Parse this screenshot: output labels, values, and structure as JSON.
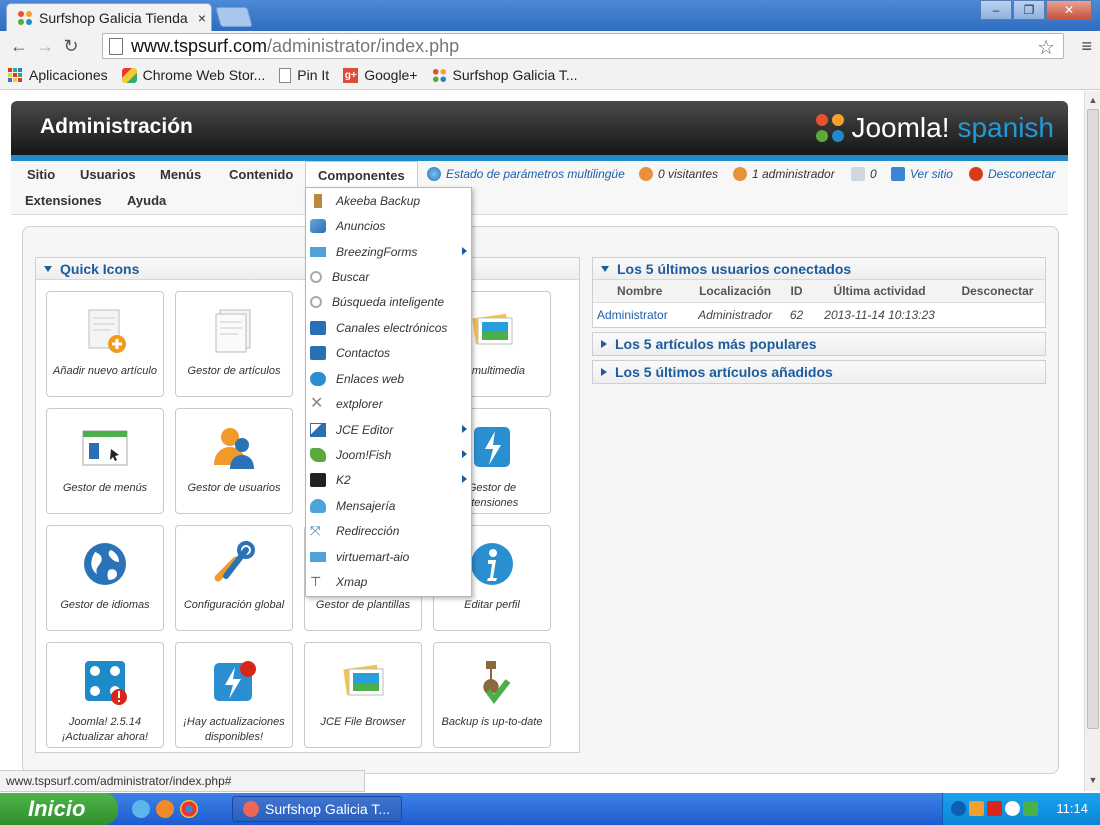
{
  "browser": {
    "tab_title": "Surfshop Galicia Tienda",
    "tab_close": "×",
    "url_host": "www.tspsurf.com",
    "url_path": "/administrator/index.php",
    "bookmarks": [
      "Aplicaciones",
      "Chrome Web Stor...",
      "Pin It",
      "Google+",
      "Surfshop Galicia T..."
    ],
    "status_url": "www.tspsurf.com/administrator/index.php#"
  },
  "header": {
    "title": "Administración",
    "logo_main": "Joomla!",
    "logo_lang": "spanish"
  },
  "menu": {
    "items": [
      "Sitio",
      "Usuarios",
      "Menús",
      "Contenido",
      "Componentes"
    ],
    "items_row2": [
      "Extensiones",
      "Ayuda"
    ],
    "status": {
      "multilang": "Estado de parámetros multilingüe",
      "visitors": "0 visitantes",
      "admins": "1 administrador",
      "messages": "0",
      "view_site": "Ver sitio",
      "logout": "Desconectar"
    }
  },
  "components_menu": [
    {
      "label": "Akeeba Backup",
      "icon": "akeeba-icon",
      "submenu": false
    },
    {
      "label": "Anuncios",
      "icon": "banners-icon",
      "submenu": false
    },
    {
      "label": "BreezingForms",
      "icon": "breezingforms-icon",
      "submenu": true
    },
    {
      "label": "Buscar",
      "icon": "search-icon",
      "submenu": false
    },
    {
      "label": "Búsqueda inteligente",
      "icon": "smart-search-icon",
      "submenu": false
    },
    {
      "label": "Canales electrónicos",
      "icon": "rss-icon",
      "submenu": false
    },
    {
      "label": "Contactos",
      "icon": "contacts-icon",
      "submenu": false
    },
    {
      "label": "Enlaces web",
      "icon": "weblinks-icon",
      "submenu": false
    },
    {
      "label": "extplorer",
      "icon": "extplorer-icon",
      "submenu": false
    },
    {
      "label": "JCE Editor",
      "icon": "jce-icon",
      "submenu": true
    },
    {
      "label": "Joom!Fish",
      "icon": "joomfish-icon",
      "submenu": true
    },
    {
      "label": "K2",
      "icon": "k2-icon",
      "submenu": true
    },
    {
      "label": "Mensajería",
      "icon": "messaging-icon",
      "submenu": false
    },
    {
      "label": "Redirección",
      "icon": "redirect-icon",
      "submenu": false
    },
    {
      "label": "virtuemart-aio",
      "icon": "virtuemart-icon",
      "submenu": false
    },
    {
      "label": "Xmap",
      "icon": "sitemap-icon",
      "submenu": false
    }
  ],
  "quick_icons": {
    "title": "Quick Icons",
    "items": [
      {
        "label": "Añadir nuevo artículo",
        "icon": "add-article-icon"
      },
      {
        "label": "Gestor de artículos",
        "icon": "article-manager-icon"
      },
      {
        "label": "Gestor de menús",
        "icon": "menu-manager-icon"
      },
      {
        "label": "Gestor de usuarios",
        "icon": "user-manager-icon"
      },
      {
        "label": "Gestor de idiomas",
        "icon": "language-icon"
      },
      {
        "label": "Configuración global",
        "icon": "config-icon"
      },
      {
        "label": "Gestor de plantillas",
        "icon": "template-icon"
      },
      {
        "label": "Editar perfil",
        "icon": "profile-icon"
      },
      {
        "label": "Joomla! 2.5.14 ¡Actualizar ahora!",
        "icon": "joomla-update-icon"
      },
      {
        "label": "¡Hay actualizaciones disponibles!",
        "icon": "updates-icon"
      },
      {
        "label": "JCE File Browser",
        "icon": "file-browser-icon"
      },
      {
        "label": "Backup is up-to-date",
        "icon": "backup-ok-icon"
      }
    ],
    "partial": [
      "or multimedia",
      "Gestor de",
      "xtensiones"
    ]
  },
  "right_panels": {
    "users_title": "Los 5 últimos usuarios conectados",
    "columns": [
      "Nombre",
      "Localización",
      "ID",
      "Última actividad",
      "Desconectar"
    ],
    "rows": [
      [
        "Administrator",
        "Administrador",
        "62",
        "2013-11-14 10:13:23",
        ""
      ]
    ],
    "popular_title": "Los 5 artículos más populares",
    "latest_title": "Los 5 últimos artículos añadidos"
  },
  "taskbar": {
    "start": "Inicio",
    "task": "Surfshop Galicia T...",
    "clock": "11:14"
  },
  "colors": {
    "accent": "#1c5b9d",
    "header_dark": "#161616",
    "blue_line": "#1e8ac8",
    "logout_red": "#d83a1a"
  }
}
